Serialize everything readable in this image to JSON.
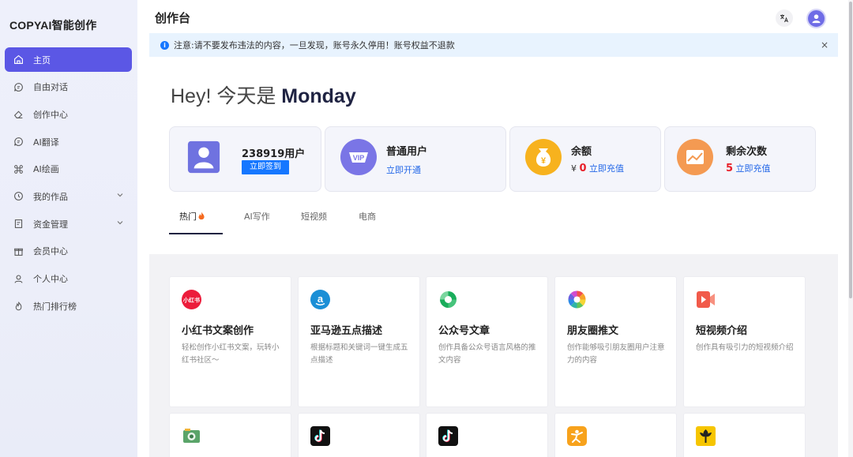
{
  "app": {
    "brand": "COPYAI智能创作",
    "page_title": "创作台"
  },
  "sidebar": {
    "items": [
      {
        "label": "主页",
        "icon": "home-icon",
        "active": true
      },
      {
        "label": "自由对话",
        "icon": "chat-icon"
      },
      {
        "label": "创作中心",
        "icon": "eraser-icon"
      },
      {
        "label": "AI翻译",
        "icon": "chat-icon"
      },
      {
        "label": "AI绘画",
        "icon": "command-icon"
      },
      {
        "label": "我的作品",
        "icon": "history-icon",
        "expandable": true
      },
      {
        "label": "资金管理",
        "icon": "receipt-icon",
        "expandable": true
      },
      {
        "label": "会员中心",
        "icon": "gift-icon"
      },
      {
        "label": "个人中心",
        "icon": "user-icon"
      },
      {
        "label": "热门排行榜",
        "icon": "flame-icon"
      }
    ]
  },
  "notice": {
    "text": "注意:请不要发布违法的内容，一旦发现，账号永久停用！账号权益不退款",
    "close": "×"
  },
  "greeting": {
    "prefix": "Hey! 今天是 ",
    "day": "Monday"
  },
  "stats": {
    "user": {
      "title": "238919用户",
      "button": "立即签到",
      "icon": "user-portrait-icon"
    },
    "plan": {
      "title": "普通用户",
      "link": "立即开通",
      "icon": "vip-icon"
    },
    "balance": {
      "title": "余额",
      "currency": "¥",
      "amount": "0",
      "link": "立即充值",
      "icon": "money-bag-icon"
    },
    "remaining": {
      "title": "剩余次数",
      "amount": "5",
      "link": "立即充值",
      "icon": "chart-card-icon"
    }
  },
  "tabs": [
    {
      "label": "热门",
      "active": true,
      "icon": "fire-icon"
    },
    {
      "label": "AI写作"
    },
    {
      "label": "短视频"
    },
    {
      "label": "电商"
    }
  ],
  "cards": [
    {
      "title": "小红书文案创作",
      "desc": "轻松创作小红书文案，玩转小红书社区～",
      "icon": "xiaohongshu-icon",
      "icon_text": "小红书"
    },
    {
      "title": "亚马逊五点描述",
      "desc": "根据标题和关键词一键生成五点描述",
      "icon": "amazon-icon"
    },
    {
      "title": "公众号文章",
      "desc": "创作具备公众号语言风格的推文内容",
      "icon": "wechat-official-icon"
    },
    {
      "title": "朋友圈推文",
      "desc": "创作能够吸引朋友圈用户注意力的内容",
      "icon": "moments-icon"
    },
    {
      "title": "短视频介绍",
      "desc": "创作具有吸引力的短视频介绍",
      "icon": "video-icon"
    },
    {
      "title": "",
      "desc": "",
      "icon": "camera-money-icon"
    },
    {
      "title": "",
      "desc": "",
      "icon": "tiktok-icon"
    },
    {
      "title": "",
      "desc": "",
      "icon": "tiktok-icon"
    },
    {
      "title": "",
      "desc": "",
      "icon": "runner-icon"
    },
    {
      "title": "",
      "desc": "",
      "icon": "flower-icon"
    }
  ],
  "colors": {
    "accent": "#5b57e5",
    "link": "#2468e8",
    "red": "#e8202a",
    "notice_bg": "#e8f3fe"
  }
}
